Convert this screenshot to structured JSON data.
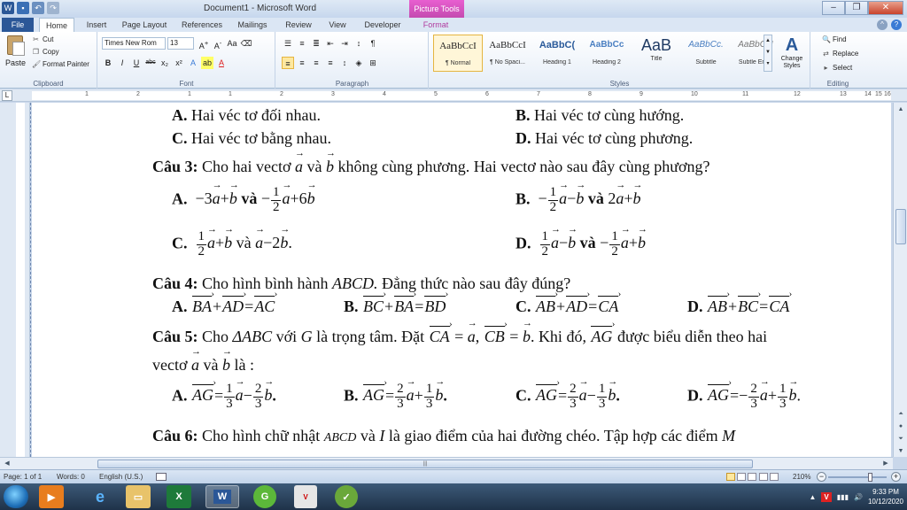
{
  "window": {
    "title": "Document1 - Microsoft Word",
    "context_tab_group": "Picture Tools"
  },
  "tabs": [
    "File",
    "Home",
    "Insert",
    "Page Layout",
    "References",
    "Mailings",
    "Review",
    "View",
    "Developer",
    "Format"
  ],
  "ribbon": {
    "clipboard": {
      "paste": "Paste",
      "cut": "Cut",
      "copy": "Copy",
      "format_painter": "Format Painter",
      "label": "Clipboard"
    },
    "font": {
      "name": "Times New Rom",
      "size": "13",
      "label": "Font"
    },
    "paragraph": {
      "label": "Paragraph"
    },
    "styles": {
      "label": "Styles",
      "items": [
        {
          "sample": "AaBbCcI",
          "name": "¶ Normal"
        },
        {
          "sample": "AaBbCcI",
          "name": "¶ No Spaci..."
        },
        {
          "sample": "AaBbC(",
          "name": "Heading 1"
        },
        {
          "sample": "AaBbCc",
          "name": "Heading 2"
        },
        {
          "sample": "AaB",
          "name": "Title"
        },
        {
          "sample": "AaBbCc.",
          "name": "Subtitle"
        },
        {
          "sample": "AaBbCcI",
          "name": "Subtle Em..."
        }
      ],
      "change_styles": "Change Styles"
    },
    "editing": {
      "find": "Find",
      "replace": "Replace",
      "select": "Select",
      "label": "Editing"
    }
  },
  "ruler": {
    "ticks": [
      "1",
      "2",
      "1",
      "1",
      "2",
      "3",
      "4",
      "5",
      "6",
      "7",
      "8",
      "9",
      "10",
      "11",
      "12",
      "13",
      "14",
      "15",
      "16"
    ]
  },
  "doc": {
    "l1a_label": "A.",
    "l1a_text": " Hai véc tơ đối nhau.",
    "l1b_label": "B.",
    "l1b_text": " Hai véc tơ cùng hướng.",
    "l2a_label": "C.",
    "l2a_text": " Hai véc tơ bằng nhau.",
    "l2b_label": "D.",
    "l2b_text": " Hai véc tơ cùng phương.",
    "q3_label": "Câu 3:",
    "q3_text_1": " Cho hai vectơ ",
    "q3_text_2": " và ",
    "q3_text_3": " không cùng phương. Hai vectơ nào sau đây cùng phương?",
    "vec_a": "a",
    "vec_b": "b",
    "q3a_label": "A.",
    "q3b_label": "B.",
    "q3c_label": "C.",
    "q3d_label": "D.",
    "va": "và",
    "q4_label": "Câu 4:",
    "q4_text_1": " Cho hình bình hành ",
    "q4_abcd": "ABCD.",
    "q4_text_2": " Đẳng thức nào sau đây đúng?",
    "q5_label": "Câu 5:",
    "q5_text_1": " Cho ",
    "q5_tri": "ΔABC",
    "q5_text_2": " với ",
    "q5_g": "G",
    "q5_text_3": " là trọng tâm. Đặt ",
    "q5_text_4": " Khi đó, ",
    "q5_text_5": " được biểu diễn theo hai",
    "q5_line2_1": "vectơ ",
    "q5_line2_2": " là :",
    "q6_label": "Câu 6:",
    "q6_text_1": " Cho hình chữ nhật ",
    "q6_abcd": "ABCD",
    "q6_text_2": " và ",
    "q6_i": "I",
    "q6_text_3": " là giao điểm của hai đường chéo. Tập hợp các điểm ",
    "q6_m": "M"
  },
  "status": {
    "page": "Page: 1 of 1",
    "words": "Words: 0",
    "language": "English (U.S.)",
    "zoom": "210%"
  },
  "taskbar": {
    "time": "9:33 PM",
    "date": "10/12/2020"
  }
}
